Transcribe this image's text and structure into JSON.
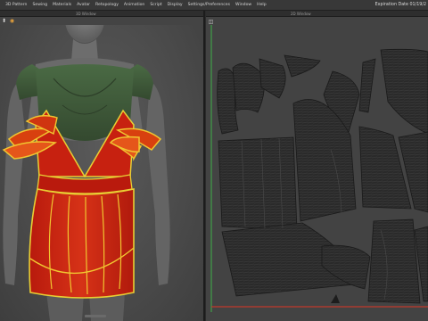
{
  "menubar": {
    "items": [
      "3D Pattern",
      "Sewing",
      "Materials",
      "Avatar",
      "Retopology",
      "Animation",
      "Script",
      "Display",
      "Settings/Preferences",
      "Window",
      "Help"
    ],
    "expiry": "Expiration Date 01/19/2"
  },
  "panes": {
    "left_title": "3D Window",
    "right_title": "2D Window"
  },
  "colors": {
    "accent": "#e6a23c",
    "dress_red": "#c92312",
    "dress_edge": "#e8cf34",
    "bodice_green": "#3f5a3a",
    "uv_line": "#c0392b",
    "uv_axis": "#3fb24a"
  }
}
